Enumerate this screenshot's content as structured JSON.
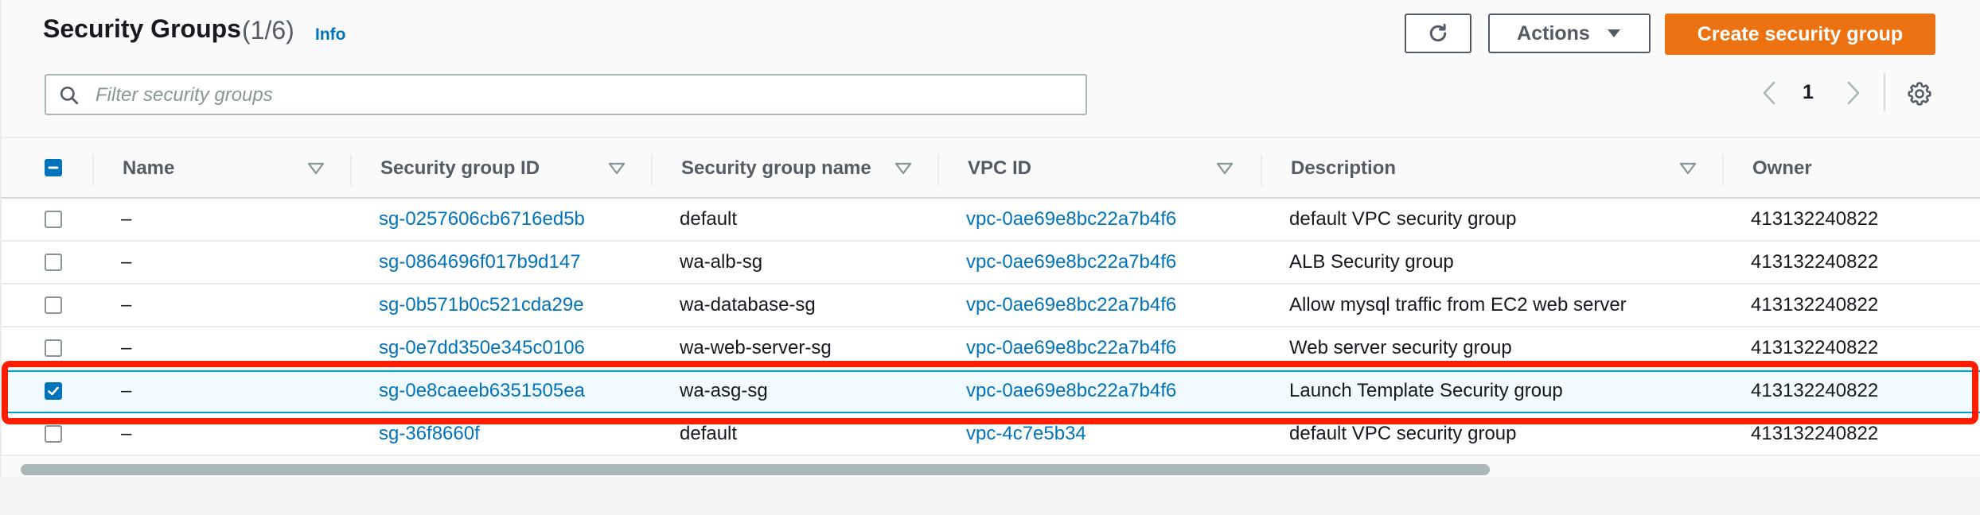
{
  "header": {
    "title": "Security Groups",
    "count": "(1/6)",
    "info_link": "Info",
    "actions_label": "Actions",
    "create_label": "Create security group"
  },
  "search": {
    "placeholder": "Filter security groups",
    "value": ""
  },
  "pagination": {
    "current_page": "1"
  },
  "table": {
    "columns": [
      "Name",
      "Security group ID",
      "Security group name",
      "VPC ID",
      "Description",
      "Owner"
    ],
    "rows": [
      {
        "name": "–",
        "id": "sg-0257606cb6716ed5b",
        "group_name": "default",
        "vpc": "vpc-0ae69e8bc22a7b4f6",
        "description": "default VPC security group",
        "owner": "413132240822",
        "selected": false
      },
      {
        "name": "–",
        "id": "sg-0864696f017b9d147",
        "group_name": "wa-alb-sg",
        "vpc": "vpc-0ae69e8bc22a7b4f6",
        "description": "ALB Security group",
        "owner": "413132240822",
        "selected": false
      },
      {
        "name": "–",
        "id": "sg-0b571b0c521cda29e",
        "group_name": "wa-database-sg",
        "vpc": "vpc-0ae69e8bc22a7b4f6",
        "description": "Allow mysql traffic from EC2 web server",
        "owner": "413132240822",
        "selected": false
      },
      {
        "name": "–",
        "id": "sg-0e7dd350e345c0106",
        "group_name": "wa-web-server-sg",
        "vpc": "vpc-0ae69e8bc22a7b4f6",
        "description": "Web server security group",
        "owner": "413132240822",
        "selected": false
      },
      {
        "name": "–",
        "id": "sg-0e8caeeb6351505ea",
        "group_name": "wa-asg-sg",
        "vpc": "vpc-0ae69e8bc22a7b4f6",
        "description": "Launch Template Security group",
        "owner": "413132240822",
        "selected": true
      },
      {
        "name": "–",
        "id": "sg-36f8660f",
        "group_name": "default",
        "vpc": "vpc-4c7e5b34",
        "description": "default VPC security group",
        "owner": "413132240822",
        "selected": false
      }
    ]
  },
  "icons": {
    "refresh": "refresh-icon",
    "actions_caret": "caret-down-icon",
    "search": "search-icon",
    "prev": "chevron-left-icon",
    "next": "chevron-right-icon",
    "settings": "gear-icon",
    "sort": "sort-caret-icon"
  },
  "colors": {
    "primary": "#ec7211",
    "link": "#0073bb",
    "highlight": "#ff1f00"
  }
}
